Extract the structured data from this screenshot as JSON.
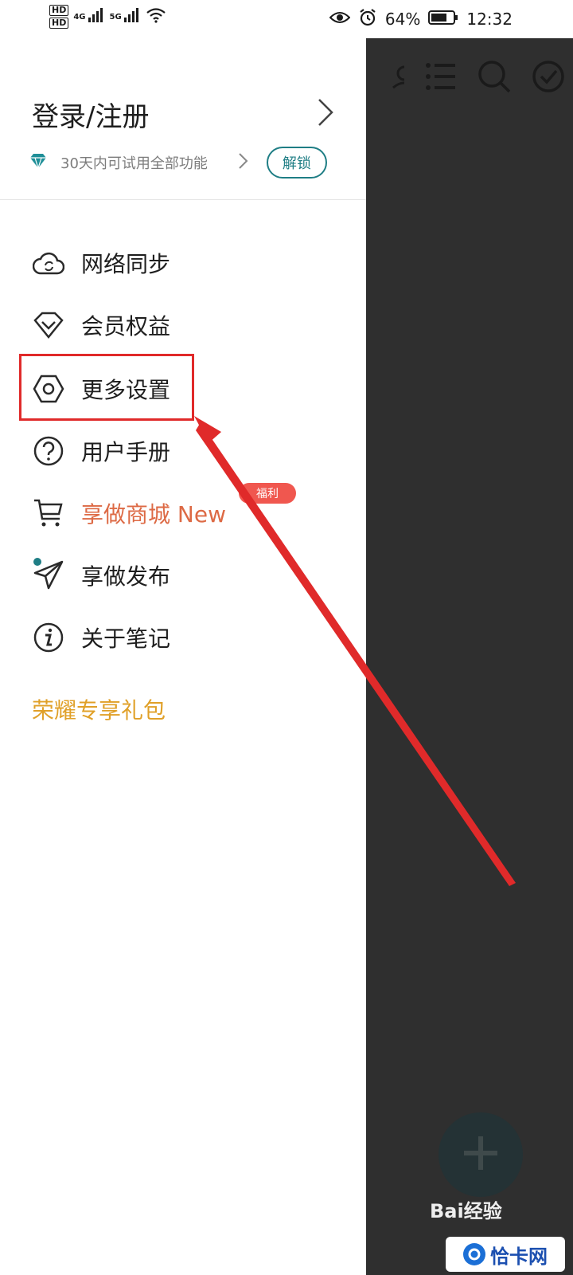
{
  "status_bar": {
    "hd1": "HD",
    "hd2": "HD",
    "net_4g": "4G",
    "net_5g": "5G",
    "battery": "64%",
    "time": "12:32",
    "icons": [
      "eye-icon",
      "alarm-icon",
      "battery-icon",
      "wifi-icon",
      "signal-icon"
    ]
  },
  "drawer": {
    "login_label": "登录/注册",
    "trial_text": "30天内可试用全部功能",
    "unlock_label": "解锁",
    "menu": [
      {
        "label": "网络同步",
        "icon": "cloud-sync-icon"
      },
      {
        "label": "会员权益",
        "icon": "diamond-icon"
      },
      {
        "label": "更多设置",
        "icon": "settings-hexagon-icon"
      },
      {
        "label": "用户手册",
        "icon": "question-circle-icon"
      },
      {
        "label": "享做商城 New",
        "icon": "cart-icon",
        "badge": "福利"
      },
      {
        "label": "享做发布",
        "icon": "paper-plane-icon"
      },
      {
        "label": "关于笔记",
        "icon": "info-circle-icon"
      }
    ],
    "gift_label": "荣耀专享礼包"
  },
  "background_app": {
    "toolbar_icons": [
      "person-icon",
      "list-icon",
      "search-icon",
      "check-circle-icon"
    ],
    "fab_icon": "plus-icon"
  },
  "watermarks": {
    "baidu": "Bai经验",
    "site": "恰卡网"
  },
  "colors": {
    "accent": "#1f7e85",
    "shop": "#dd6a45",
    "gift": "#e0a028",
    "badge": "#f0574f",
    "highlight": "#e02a2a"
  }
}
